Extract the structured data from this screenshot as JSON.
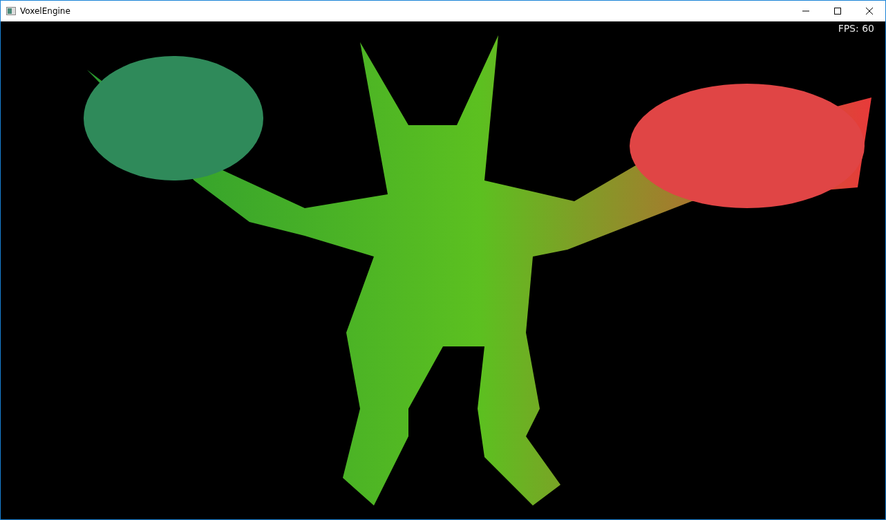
{
  "window": {
    "title": "VoxelEngine"
  },
  "viewport": {
    "fps": "FPS: 60"
  }
}
